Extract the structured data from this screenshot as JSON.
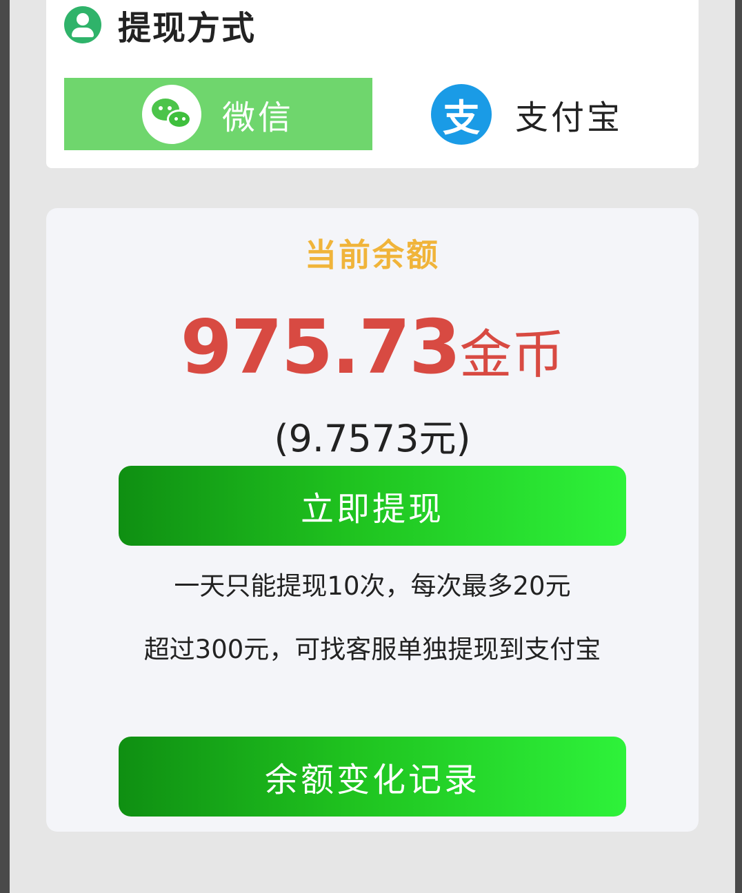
{
  "withdraw_method": {
    "title": "提现方式",
    "options": [
      {
        "label": "微信",
        "selected": true
      },
      {
        "label": "支付宝",
        "selected": false
      }
    ],
    "alipay_icon_glyph": "支"
  },
  "balance": {
    "label": "当前余额",
    "amount": "975.73",
    "unit": "金币",
    "yuan": "(9.7573元)"
  },
  "actions": {
    "withdraw_label": "立即提现",
    "history_label": "余额变化记录"
  },
  "notes": [
    "一天只能提现10次，每次最多20元",
    "超过300元，可找客服单独提现到支付宝"
  ],
  "colors": {
    "accent_green": "#6fd66d",
    "balance_red": "#d84a42",
    "label_gold": "#f0b43a",
    "alipay_blue": "#1a9be6"
  }
}
